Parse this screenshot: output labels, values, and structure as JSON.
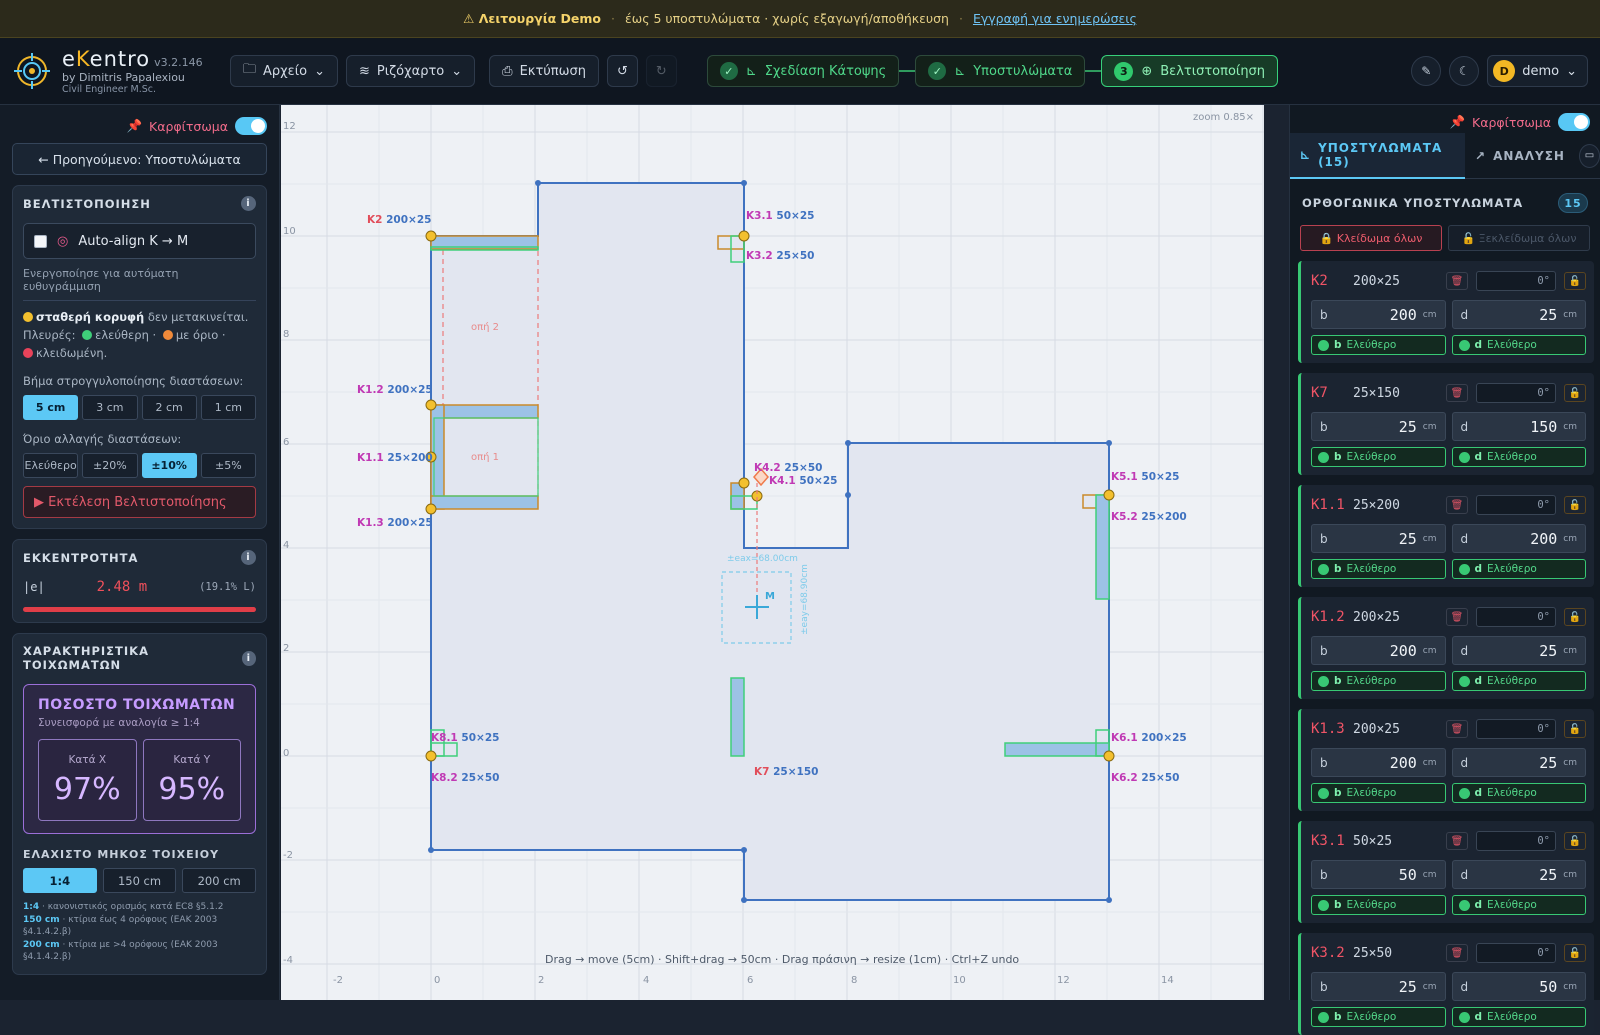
{
  "banner": {
    "mode": "⚠ Λειτουργία Demo",
    "limit": "έως 5 υποστυλώματα · χωρίς εξαγωγή/αποθήκευση",
    "link": "Εγγραφή για ενημερώσεις"
  },
  "brand": {
    "title_e": "e",
    "title_k": "K",
    "title_rest": "entro",
    "version": "v3.2.146",
    "by": "by Dimitris Papalexiou",
    "sub": "Civil Engineer M.Sc."
  },
  "toolbar": {
    "file": "Αρχείο",
    "background": "Ριζόχαρτο",
    "print": "Εκτύπωση"
  },
  "stepper": {
    "step1": "Σχεδίαση Κάτοψης",
    "step2": "Υποστυλώματα",
    "step3_num": "3",
    "step3": "Βελτιστοποίηση"
  },
  "user": {
    "initial": "D",
    "name": "demo"
  },
  "left": {
    "pin": "Καρφίτσωμα",
    "prev": "← Προηγούμενο: Υποστυλώματα",
    "optim": {
      "title": "ΒΕΛΤΙΣΤΟΠΟΙΗΣΗ",
      "autoalign": "Auto-align K → M",
      "autoalign_hint": "Ενεργοποίησε για αυτόματη ευθυγράμμιση",
      "fixed_strong": "σταθερή κορυφή",
      "fixed_rest": "δεν μετακινείται.",
      "sides": "Πλευρές:",
      "free": "ελεύθερη ·",
      "limited": "με όριο ·",
      "locked": "κλειδωμένη.",
      "rounding_label": "Βήμα στρογγυλοποίησης διαστάσεων:",
      "rounding": [
        "5 cm",
        "3 cm",
        "2 cm",
        "1 cm"
      ],
      "limit_label": "Όριο αλλαγής διαστάσεων:",
      "limits": [
        "Ελεύθερο",
        "±20%",
        "±10%",
        "±5%"
      ],
      "run": "▶ Εκτέλεση Βελτιστοποίησης"
    },
    "ecc": {
      "title": "ΕΚΚΕΝΤΡΟΤΗΤΑ",
      "label": "|e|",
      "value": "2.48 m",
      "pct": "(19.1% L)",
      "bar_fraction": 1.0
    },
    "walls": {
      "title": "ΧΑΡΑΚΤΗΡΙΣΤΙΚΑ ΤΟΙΧΩΜΑΤΩΝ",
      "box_title": "ΠΟΣΟΣΤΟ ΤΟΙΧΩΜΑΤΩΝ",
      "box_sub": "Συνεισφορά με αναλογία ≥ 1:4",
      "x_label": "Κατά X",
      "x_val": "97%",
      "y_label": "Κατά Y",
      "y_val": "95%",
      "minlen_title": "ΕΛΑΧΙΣΤΟ ΜΗΚΟΣ ΤΟΙΧΕΙΟΥ",
      "minlen": [
        "1:4",
        "150 cm",
        "200 cm"
      ],
      "note1_k": "1:4",
      "note1": "· κανονιστικός ορισμός κατά EC8 §5.1.2",
      "note2_k": "150 cm",
      "note2": "· κτίρια έως 4 ορόφους (ΕΑΚ 2003 §4.1.4.2.β)",
      "note3_k": "200 cm",
      "note3": "· κτίρια με >4 ορόφους (ΕΑΚ 2003 §4.1.4.2.β)"
    }
  },
  "canvas": {
    "zoom": "zoom 0.85×",
    "hint": "Drag → move (5cm) · Shift+drag → 50cm · Drag πράσινη → resize (1cm) · Ctrl+Z undo",
    "x_ticks": [
      "-2",
      "0",
      "2",
      "4",
      "6",
      "8",
      "10",
      "12",
      "14"
    ],
    "y_ticks": [
      "12",
      "10",
      "8",
      "6",
      "4",
      "2",
      "0",
      "-2",
      "-4"
    ],
    "openings": [
      "οπή 2",
      "οπή 1"
    ],
    "ex": "±eax=68.00cm",
    "ey": "±eay=68.90cm",
    "m": "M",
    "labels": {
      "K2": "K2",
      "K2d": "200×25",
      "K31": "K3.1",
      "K31d": "50×25",
      "K32": "K3.2",
      "K32d": "25×50",
      "K12": "K1.2",
      "K12d": "200×25",
      "K11": "K1.1",
      "K11d": "25×200",
      "K13": "K1.3",
      "K13d": "200×25",
      "K42": "K4.2",
      "K42d": "25×50",
      "K41": "K4.1",
      "K41d": "50×25",
      "K51": "K5.1",
      "K51d": "50×25",
      "K52": "K5.2",
      "K52d": "25×200",
      "K81": "K8.1",
      "K81d": "50×25",
      "K82": "K8.2",
      "K82d": "25×50",
      "K7": "K7",
      "K7d": "25×150",
      "K61": "K6.1",
      "K61d": "200×25",
      "K62": "K6.2",
      "K62d": "25×50"
    }
  },
  "right": {
    "pin": "Καρφίτσωμα",
    "tab1": "ΥΠΟΣΤΥΛΩΜΑΤΑ (15)",
    "tab2": "ΑΝΑΛΥΣΗ",
    "section": "ΟΡΘΟΓΩΝΙΚΑ ΥΠΟΣΤΥΛΩΜΑΤΑ",
    "count": "15",
    "lock_all": "🔒 Κλείδωμα όλων",
    "unlock_all": "🔓 Ξεκλείδωμα όλων",
    "free": "Ελεύθερο",
    "unit": "cm",
    "columns": [
      {
        "name": "K2",
        "dim": "200×25",
        "angle": "0°",
        "b": "200",
        "d": "25"
      },
      {
        "name": "K7",
        "dim": "25×150",
        "angle": "0°",
        "b": "25",
        "d": "150"
      },
      {
        "name": "K1.1",
        "dim": "25×200",
        "angle": "0°",
        "b": "25",
        "d": "200"
      },
      {
        "name": "K1.2",
        "dim": "200×25",
        "angle": "0°",
        "b": "200",
        "d": "25"
      },
      {
        "name": "K1.3",
        "dim": "200×25",
        "angle": "0°",
        "b": "200",
        "d": "25"
      },
      {
        "name": "K3.1",
        "dim": "50×25",
        "angle": "0°",
        "b": "50",
        "d": "25"
      },
      {
        "name": "K3.2",
        "dim": "25×50",
        "angle": "0°",
        "b": "25",
        "d": "50"
      }
    ]
  }
}
